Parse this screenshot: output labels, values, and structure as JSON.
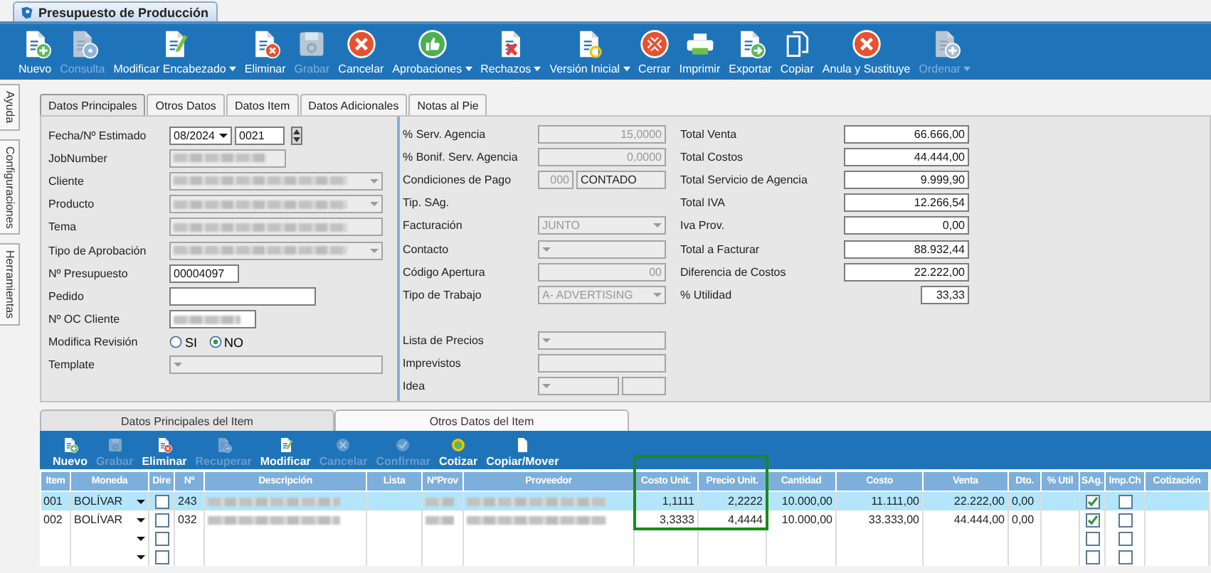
{
  "document_tab": {
    "title": "Presupuesto de Producción"
  },
  "toolbar": [
    {
      "label": "Nuevo",
      "disabled": false,
      "dropdown": false
    },
    {
      "label": "Consulta",
      "disabled": true,
      "dropdown": false
    },
    {
      "label": "Modificar Encabezado",
      "disabled": false,
      "dropdown": true
    },
    {
      "label": "Eliminar",
      "disabled": false,
      "dropdown": false
    },
    {
      "label": "Grabar",
      "disabled": true,
      "dropdown": false
    },
    {
      "label": "Cancelar",
      "disabled": false,
      "dropdown": false
    },
    {
      "label": "Aprobaciones",
      "disabled": false,
      "dropdown": true
    },
    {
      "label": "Rechazos",
      "disabled": false,
      "dropdown": true
    },
    {
      "label": "Versión Inicial",
      "disabled": false,
      "dropdown": true
    },
    {
      "label": "Cerrar",
      "disabled": false,
      "dropdown": false
    },
    {
      "label": "Imprimir",
      "disabled": false,
      "dropdown": false
    },
    {
      "label": "Exportar",
      "disabled": false,
      "dropdown": false
    },
    {
      "label": "Copiar",
      "disabled": false,
      "dropdown": false
    },
    {
      "label": "Anula y Sustituye",
      "disabled": false,
      "dropdown": false
    },
    {
      "label": "Ordenar",
      "disabled": true,
      "dropdown": true
    }
  ],
  "side_tabs": [
    "Ayuda",
    "Configuraciones",
    "Herramientas"
  ],
  "tabs": [
    {
      "label": "Datos Principales",
      "selected": true
    },
    {
      "label": "Otros Datos",
      "selected": false
    },
    {
      "label": "Datos Item",
      "selected": false
    },
    {
      "label": "Datos Adicionales",
      "selected": false
    },
    {
      "label": "Notas al Pie",
      "selected": false
    }
  ],
  "form_left": [
    {
      "label": "Fecha/Nº Estimado",
      "controls": [
        {
          "kind": "combo",
          "value": "08/2024",
          "disabled": false
        },
        {
          "kind": "spinner",
          "value": "0021",
          "disabled": false
        }
      ]
    },
    {
      "label": "JobNumber",
      "controls": [
        {
          "kind": "text",
          "blurred": true,
          "disabled": true
        }
      ]
    },
    {
      "label": "Cliente",
      "controls": [
        {
          "kind": "combo",
          "blurred": true,
          "disabled": true
        }
      ]
    },
    {
      "label": "Producto",
      "controls": [
        {
          "kind": "combo",
          "blurred": true,
          "disabled": true
        }
      ]
    },
    {
      "label": "Tema",
      "controls": [
        {
          "kind": "text",
          "blurred": true,
          "disabled": true
        }
      ]
    },
    {
      "label": "Tipo de Aprobación",
      "controls": [
        {
          "kind": "combo",
          "blurred": true,
          "disabled": true
        }
      ]
    },
    {
      "label": "Nº Presupuesto",
      "controls": [
        {
          "kind": "text",
          "value": "00004097",
          "disabled": false
        }
      ]
    },
    {
      "label": "Pedido",
      "controls": [
        {
          "kind": "text",
          "disabled": false
        }
      ]
    },
    {
      "label": "Nº OC Cliente",
      "controls": [
        {
          "kind": "text",
          "blurred": true,
          "disabled": false
        }
      ]
    },
    {
      "label": "Modifica Revisión",
      "controls": [
        {
          "kind": "radio",
          "label": "SI",
          "selected": false
        },
        {
          "kind": "radio",
          "label": "NO",
          "selected": true
        }
      ]
    },
    {
      "label": "Template",
      "controls": [
        {
          "kind": "combo",
          "disabled": true
        }
      ]
    }
  ],
  "form_middle": [
    [
      {
        "label": "% Serv. Agencia",
        "controls": [
          {
            "kind": "text",
            "value": "15,0000",
            "disabled": true
          }
        ]
      },
      {
        "label": "% Bonif. Serv. Agencia",
        "controls": [
          {
            "kind": "text",
            "value": "0,0000",
            "disabled": true
          }
        ]
      },
      {
        "label": "Condiciones de Pago",
        "controls": [
          {
            "kind": "text",
            "value": "000",
            "disabled": true
          },
          {
            "kind": "text",
            "value": "CONTADO",
            "disabled": true,
            "dark": true
          }
        ]
      },
      {
        "label": "Tip. SAg."
      },
      {
        "label": "Facturación",
        "controls": [
          {
            "kind": "combo",
            "value": "JUNTO",
            "disabled": true
          }
        ]
      },
      {
        "label": "Contacto",
        "controls": [
          {
            "kind": "combo",
            "disabled": true
          }
        ]
      },
      {
        "label": "Código Apertura",
        "controls": [
          {
            "kind": "text",
            "value": "00",
            "disabled": true
          }
        ]
      },
      {
        "label": "Tipo de Trabajo",
        "controls": [
          {
            "kind": "combo",
            "value": "A- ADVERTISING",
            "disabled": true
          }
        ]
      }
    ],
    [
      {
        "label": "Lista de Precios",
        "controls": [
          {
            "kind": "combo",
            "disabled": true
          }
        ]
      },
      {
        "label": "Imprevistos",
        "controls": [
          {
            "kind": "text",
            "disabled": true
          }
        ]
      },
      {
        "label": "Idea",
        "controls": [
          {
            "kind": "combo",
            "disabled": true
          },
          {
            "kind": "text",
            "disabled": true
          }
        ]
      }
    ]
  ],
  "totals": [
    {
      "label": "Total Venta",
      "value": "66.666,00"
    },
    {
      "label": "Total Costos",
      "value": "44.444,00"
    },
    {
      "label": "Total Servicio de Agencia",
      "value": "9.999,90"
    },
    {
      "label": "Total IVA",
      "value": "12.266,54"
    },
    {
      "label": "Iva Prov.",
      "value": "0,00"
    },
    {
      "label": "Total a Facturar",
      "value": "88.932,44"
    },
    {
      "label": "Diferencia de Costos",
      "value": "22.222,00"
    },
    {
      "label": "% Utilidad",
      "value": "33,33"
    }
  ],
  "item_tabs": [
    {
      "label": "Datos Principales del Item",
      "selected": false
    },
    {
      "label": "Otros Datos del Item",
      "selected": true
    }
  ],
  "item_toolbar": [
    {
      "label": "Nuevo",
      "disabled": false
    },
    {
      "label": "Grabar",
      "disabled": true
    },
    {
      "label": "Eliminar",
      "disabled": false
    },
    {
      "label": "Recuperar",
      "disabled": true
    },
    {
      "label": "Modificar",
      "disabled": false
    },
    {
      "label": "Cancelar",
      "disabled": true
    },
    {
      "label": "Confirmar",
      "disabled": true
    },
    {
      "label": "Cotizar",
      "disabled": false
    },
    {
      "label": "Copiar/Mover",
      "disabled": false
    }
  ],
  "table": {
    "columns": [
      {
        "label": "Item",
        "highlighted": false
      },
      {
        "label": "Moneda",
        "highlighted": false
      },
      {
        "label": "Dire",
        "highlighted": false
      },
      {
        "label": "Nº",
        "highlighted": false
      },
      {
        "label": "Descripción",
        "highlighted": false
      },
      {
        "label": "Lista",
        "highlighted": false
      },
      {
        "label": "NºProv",
        "highlighted": false
      },
      {
        "label": "Proveedor",
        "highlighted": false
      },
      {
        "label": "Costo Unit.",
        "highlighted": true
      },
      {
        "label": "Precio Unit.",
        "highlighted": true
      },
      {
        "label": "Cantidad",
        "highlighted": false
      },
      {
        "label": "Costo",
        "highlighted": false
      },
      {
        "label": "Venta",
        "highlighted": false
      },
      {
        "label": "Dto.",
        "highlighted": false
      },
      {
        "label": "% Util",
        "highlighted": false
      },
      {
        "label": "SAg.",
        "highlighted": false
      },
      {
        "label": "Imp.Ch",
        "highlighted": false
      },
      {
        "label": "Cotización",
        "highlighted": false
      }
    ],
    "rows": [
      {
        "selected": true,
        "highlighted": true,
        "cells": [
          {
            "kind": "text",
            "text": "001"
          },
          {
            "kind": "dropdown",
            "text": "BOLÍVAR"
          },
          {
            "kind": "checkbox",
            "checked": false
          },
          {
            "kind": "text",
            "text": "243"
          },
          {
            "kind": "blurred"
          },
          {
            "kind": "empty"
          },
          {
            "kind": "blurred"
          },
          {
            "kind": "blurred"
          },
          {
            "kind": "text",
            "text": "1,1111"
          },
          {
            "kind": "text",
            "text": "2,2222"
          },
          {
            "kind": "text",
            "text": "10.000,00"
          },
          {
            "kind": "text",
            "text": "11.111,00"
          },
          {
            "kind": "text",
            "text": "22.222,00"
          },
          {
            "kind": "text",
            "text": "0,00"
          },
          {
            "kind": "empty"
          },
          {
            "kind": "checkbox",
            "checked": true
          },
          {
            "kind": "checkbox",
            "checked": false
          },
          {
            "kind": "empty"
          }
        ]
      },
      {
        "selected": false,
        "highlighted": true,
        "cells": [
          {
            "kind": "text",
            "text": "002"
          },
          {
            "kind": "dropdown",
            "text": "BOLÍVAR"
          },
          {
            "kind": "checkbox",
            "checked": false
          },
          {
            "kind": "text",
            "text": "032"
          },
          {
            "kind": "blurred"
          },
          {
            "kind": "empty"
          },
          {
            "kind": "blurred"
          },
          {
            "kind": "blurred"
          },
          {
            "kind": "text",
            "text": "3,3333"
          },
          {
            "kind": "text",
            "text": "4,4444"
          },
          {
            "kind": "text",
            "text": "10.000,00"
          },
          {
            "kind": "text",
            "text": "33.333,00"
          },
          {
            "kind": "text",
            "text": "44.444,00"
          },
          {
            "kind": "text",
            "text": "0,00"
          },
          {
            "kind": "empty"
          },
          {
            "kind": "checkbox",
            "checked": true
          },
          {
            "kind": "checkbox",
            "checked": false
          },
          {
            "kind": "empty"
          }
        ]
      },
      {
        "selected": false,
        "highlighted": false,
        "cells": [
          {
            "kind": "empty"
          },
          {
            "kind": "dropdown"
          },
          {
            "kind": "checkbox",
            "checked": false
          },
          {
            "kind": "empty"
          },
          {
            "kind": "empty"
          },
          {
            "kind": "empty"
          },
          {
            "kind": "empty"
          },
          {
            "kind": "empty"
          },
          {
            "kind": "empty"
          },
          {
            "kind": "empty"
          },
          {
            "kind": "empty"
          },
          {
            "kind": "empty"
          },
          {
            "kind": "empty"
          },
          {
            "kind": "empty"
          },
          {
            "kind": "empty"
          },
          {
            "kind": "checkbox",
            "checked": false
          },
          {
            "kind": "checkbox",
            "checked": false
          },
          {
            "kind": "empty"
          }
        ]
      },
      {
        "selected": false,
        "highlighted": false,
        "cells": [
          {
            "kind": "empty"
          },
          {
            "kind": "dropdown"
          },
          {
            "kind": "checkbox",
            "checked": false
          },
          {
            "kind": "empty"
          },
          {
            "kind": "empty"
          },
          {
            "kind": "empty"
          },
          {
            "kind": "empty"
          },
          {
            "kind": "empty"
          },
          {
            "kind": "empty"
          },
          {
            "kind": "empty"
          },
          {
            "kind": "empty"
          },
          {
            "kind": "empty"
          },
          {
            "kind": "empty"
          },
          {
            "kind": "empty"
          },
          {
            "kind": "empty"
          },
          {
            "kind": "checkbox",
            "checked": false
          },
          {
            "kind": "checkbox",
            "checked": false
          },
          {
            "kind": "empty"
          }
        ]
      }
    ]
  }
}
